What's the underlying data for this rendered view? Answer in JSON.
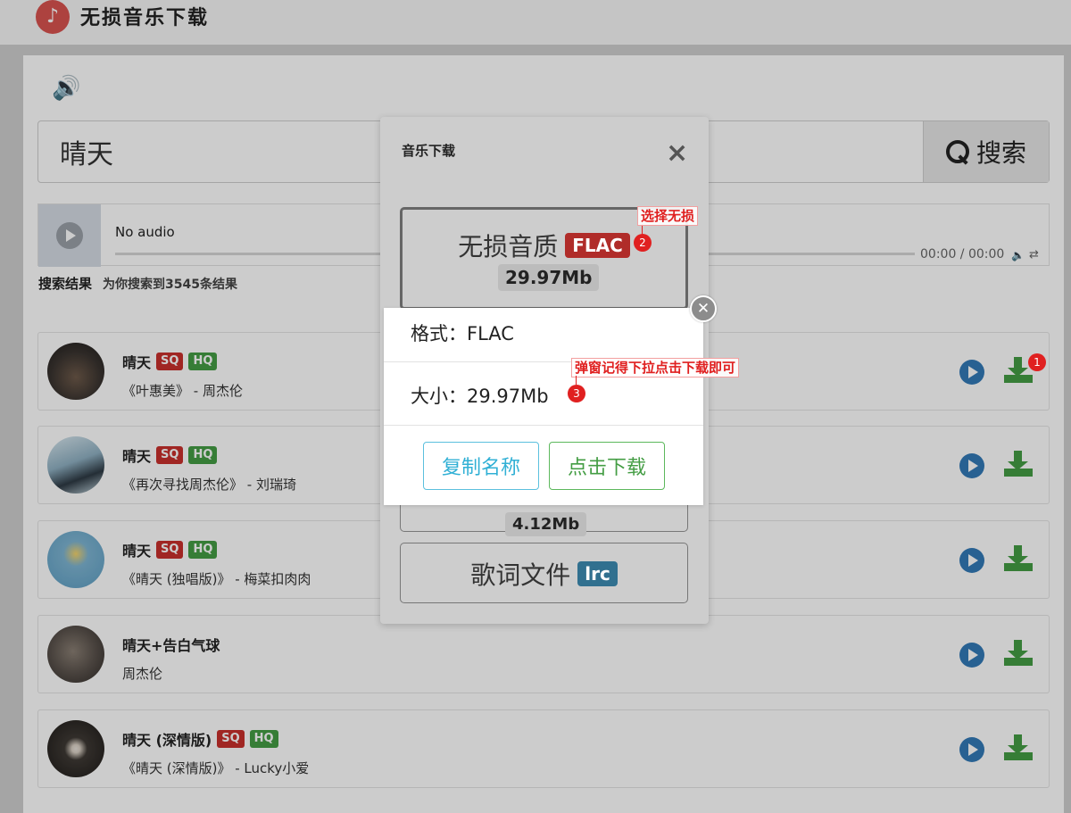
{
  "header": {
    "logo_glyph": "♪",
    "app_title": "无损音乐下载"
  },
  "search": {
    "value": "晴天",
    "button_label": "搜索"
  },
  "player": {
    "status": "No audio",
    "time": "00:00 / 00:00",
    "volume_glyph": "🔈",
    "loop_glyph": "⇄"
  },
  "results": {
    "label": "搜索结果",
    "summary": "为你搜索到3545条结果"
  },
  "songs": [
    {
      "title": "晴天",
      "badges": [
        "SQ",
        "HQ"
      ],
      "subtitle": "《叶惠美》 - 周杰伦"
    },
    {
      "title": "晴天",
      "badges": [
        "SQ",
        "HQ"
      ],
      "subtitle": "《再次寻找周杰伦》 - 刘瑞琦"
    },
    {
      "title": "晴天",
      "badges": [
        "SQ",
        "HQ"
      ],
      "subtitle": "《晴天 (独唱版)》 - 梅菜扣肉肉"
    },
    {
      "title": "晴天+告白气球",
      "badges": [],
      "subtitle": "周杰伦"
    },
    {
      "title": "晴天 (深情版)",
      "badges": [
        "SQ",
        "HQ"
      ],
      "subtitle": "《晴天 (深情版)》 - Lucky小爱"
    }
  ],
  "modal": {
    "title": "音乐下载",
    "close_glyph": "×",
    "lossless": {
      "label": "无损音质",
      "badge": "FLAC",
      "size": "29.97Mb"
    },
    "mid": {
      "size": "4.12Mb"
    },
    "lyrics": {
      "label": "歌词文件",
      "badge": "lrc"
    }
  },
  "popup": {
    "format": "格式：FLAC",
    "size": "大小：29.97Mb",
    "copy_button": "复制名称",
    "download_button": "点击下载",
    "close_glyph": "✕"
  },
  "annotations": {
    "one": {
      "number": "1"
    },
    "two": {
      "number": "2",
      "text": "选择无损"
    },
    "three": {
      "number": "3",
      "text": "弹窗记得下拉点击下载即可"
    }
  },
  "colors": {
    "sq": "#c9302c",
    "hq": "#449d44",
    "flac": "#b02c29",
    "lrc": "#31708f",
    "play": "#337ab7",
    "annotation": "#e02020"
  }
}
